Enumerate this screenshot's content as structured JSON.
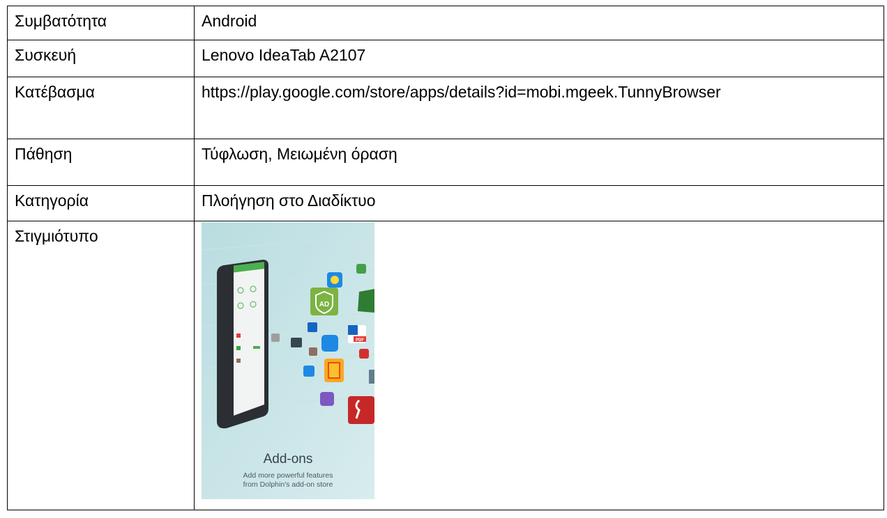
{
  "rows": [
    {
      "label": "Συμβατότητα",
      "value": "Android"
    },
    {
      "label": "Συσκευή",
      "value": "Lenovo IdeaTab A2107"
    },
    {
      "label": "Κατέβασμα",
      "value": "https://play.google.com/store/apps/details?id=mobi.mgeek.TunnyBrowser"
    },
    {
      "label": "Πάθηση",
      "value": "Τύφλωση, Μειωμένη όραση"
    },
    {
      "label": "Κατηγορία",
      "value": "Πλοήγηση στο Διαδίκτυο"
    },
    {
      "label": "Στιγμιότυπο"
    }
  ],
  "screenshot": {
    "title": "Add-ons",
    "caption_line1": "Add more powerful features",
    "caption_line2": "from Dolphin's add-on store",
    "icon_ad_text": "AD",
    "icon_pdf_text": "PDF"
  }
}
